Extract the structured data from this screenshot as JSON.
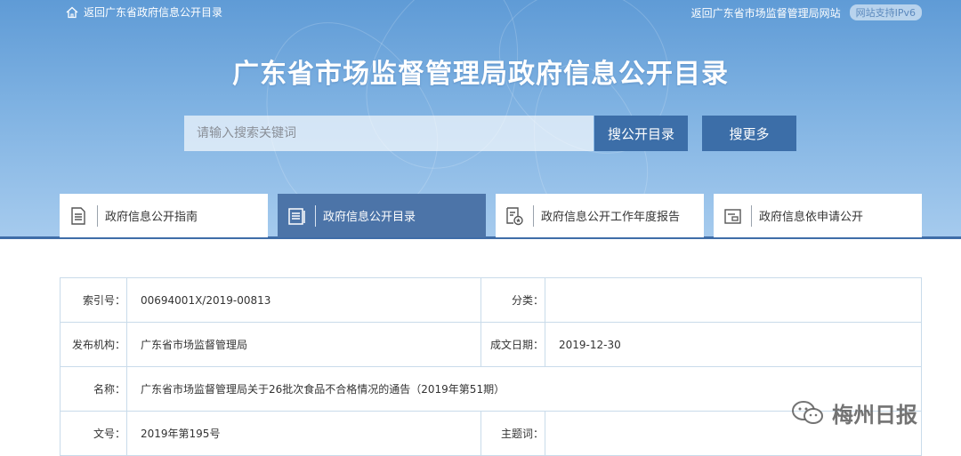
{
  "topbar": {
    "back_to_directory": "返回广东省政府信息公开目录",
    "back_to_site": "返回广东省市场监督管理局网站",
    "ipv6_badge": "网站支持IPv6"
  },
  "header": {
    "title": "广东省市场监督管理局政府信息公开目录"
  },
  "search": {
    "placeholder": "请输入搜索关键词",
    "search_directory_label": "搜公开目录",
    "search_more_label": "搜更多"
  },
  "tabs": [
    {
      "label": "政府信息公开指南",
      "icon": "document-lines-icon",
      "active": false
    },
    {
      "label": "政府信息公开目录",
      "icon": "list-icon",
      "active": true
    },
    {
      "label": "政府信息公开工作年度报告",
      "icon": "report-star-icon",
      "active": false
    },
    {
      "label": "政府信息依申请公开",
      "icon": "application-icon",
      "active": false
    }
  ],
  "info": {
    "index_label": "索引号：",
    "index_value": "00694001X/2019-00813",
    "category_label": "分类：",
    "category_value": "",
    "publisher_label": "发布机构：",
    "publisher_value": "广东省市场监督管理局",
    "date_label": "成文日期：",
    "date_value": "2019-12-30",
    "name_label": "名称：",
    "name_value": "广东省市场监督管理局关于26批次食品不合格情况的通告（2019年第51期）",
    "docno_label": "文号：",
    "docno_value": "2019年第195号",
    "subject_label": "主题词：",
    "subject_value": ""
  },
  "watermark": {
    "text": "梅州日报"
  },
  "colors": {
    "hero": "#6fa7dc",
    "accent": "#3c6ea8",
    "active_tab": "#4c74a8",
    "table_border": "#c9dbea"
  }
}
